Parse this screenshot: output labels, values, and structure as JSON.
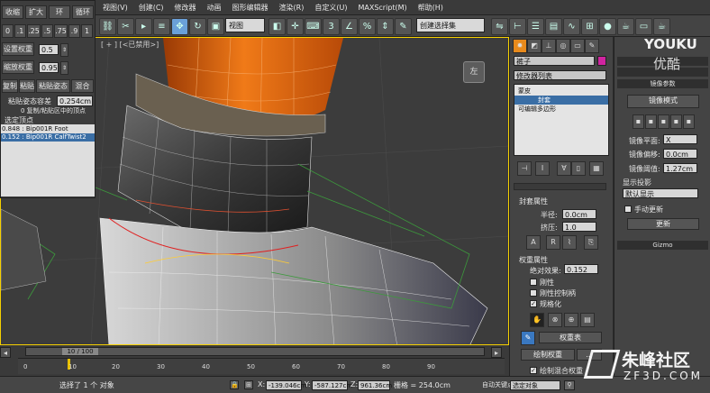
{
  "menubar": {
    "items": [
      "视图(V)",
      "创建(C)",
      "修改器",
      "动画",
      "图形编辑器",
      "渲染(R)",
      "自定义(U)",
      "MAXScript(M)",
      "帮助(H)"
    ]
  },
  "toolbar": {
    "view_select": "视图",
    "selection_set": "创建选择集"
  },
  "viewport": {
    "label": "[ + ] [<已禁用>]",
    "viewcube_label": "左"
  },
  "float_panel": {
    "row1": [
      "收缩",
      "扩大",
      "环",
      "循环"
    ],
    "row2": [
      "0",
      ".1",
      ".25",
      ".5",
      ".75",
      ".9",
      "1"
    ],
    "set_weight_label": "设置权重",
    "set_weight_value": "0.5",
    "scale_weight_label": "缩放权重",
    "scale_weight_value": "0.95",
    "row5": [
      "复制",
      "粘贴",
      "粘贴姿态",
      "混合"
    ],
    "paste_tolerance_label": "粘贴姿态容差",
    "paste_tolerance_value": "0.254cm",
    "copied_vertices": "0 复制/粘贴区中的顶点",
    "selected_vertex_label": "选定顶点",
    "list": [
      "0.848 : Bip001R Foot",
      "0.152 : Bip001R CalfTwist2"
    ]
  },
  "cmd_panel": {
    "object_name": "裤子",
    "modifier_list": "修改器列表",
    "stack": [
      "蒙皮",
      "封套",
      "可编辑多边形"
    ],
    "envelope_props_header": "封套属性",
    "radius_label": "半径:",
    "radius_value": "0.0cm",
    "squash_label": "挤压:",
    "squash_value": "1.0",
    "weight_props_header": "权重属性",
    "abs_effect_label": "绝对效果:",
    "abs_effect_value": "0.152",
    "rigid_label": "刚性",
    "rigid_handles_label": "刚性控制柄",
    "normalize_label": "规格化",
    "weight_table_button": "权重表",
    "paint_weights_button": "绘制权重",
    "paint_blend_label": "绘制混合权重"
  },
  "right_panel": {
    "bar1": "镜像参数",
    "mirror_mode_button": "镜像模式",
    "mirror_plane_label": "镜像平面:",
    "mirror_plane_value": "X",
    "mirror_offset_label": "镜像偏移:",
    "mirror_offset_value": "0.0cm",
    "mirror_threshold_label": "镜像阈值:",
    "mirror_threshold_value": "1.27cm",
    "display_projection_label": "显示投影",
    "display_projection_value": "默认显示",
    "manual_update_label": "手动更新",
    "update_button": "更新",
    "gizmo_bar": "Gizmo"
  },
  "timeline": {
    "frame_display": "10 / 100",
    "ticks": [
      "0",
      "10",
      "20",
      "30",
      "40",
      "50",
      "60",
      "70",
      "80",
      "90"
    ]
  },
  "statusbar": {
    "selection_info": "选择了 1 个 对象",
    "x_label": "X:",
    "x_value": "-139.046cm",
    "y_label": "Y:",
    "y_value": "-587.127cm",
    "z_label": "Z:",
    "z_value": "961.36cm",
    "grid_label": "栅格 = 254.0cm",
    "auto_key": "自动关键点",
    "selected_object": "选定对象"
  },
  "watermarks": {
    "youku": "YOUKU",
    "youku_cn": "优酷",
    "zf_cn": "朱峰社区",
    "zf_url": "ZF3D.COM"
  },
  "colors": {
    "viewport_border": "#f6d000",
    "selection_highlight": "#3a6ea5",
    "orange_mesh": "#e8600c"
  }
}
